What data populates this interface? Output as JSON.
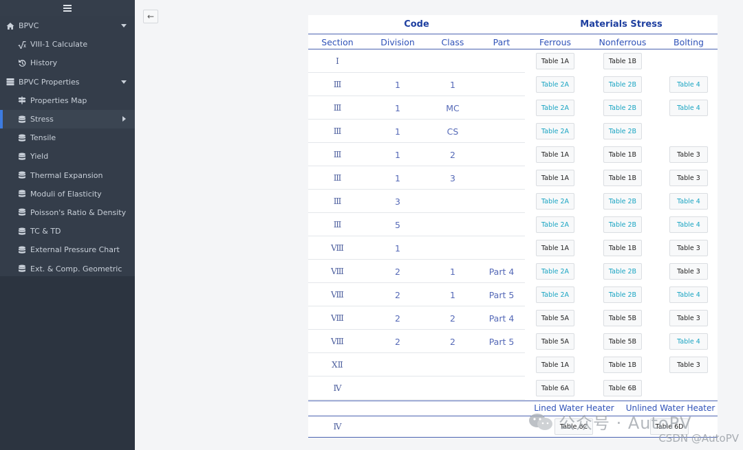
{
  "sidebar": {
    "items": [
      {
        "label": "BPVC",
        "icon": "home-icon",
        "level": 0,
        "caret": "down"
      },
      {
        "label": "VIII-1 Calculate",
        "icon": "square-root-icon",
        "level": 1
      },
      {
        "label": "History",
        "icon": "history-icon",
        "level": 1
      },
      {
        "label": "BPVC Properties",
        "icon": "server-icon",
        "level": 0,
        "caret": "down"
      },
      {
        "label": "Properties Map",
        "icon": "signpost-icon",
        "level": 1
      },
      {
        "label": "Stress",
        "icon": "database-icon",
        "level": 1,
        "active": true,
        "caret": "right"
      },
      {
        "label": "Tensile",
        "icon": "database-icon",
        "level": 1
      },
      {
        "label": "Yield",
        "icon": "database-icon",
        "level": 1
      },
      {
        "label": "Thermal Expansion",
        "icon": "database-icon",
        "level": 1
      },
      {
        "label": "Moduli of Elasticity",
        "icon": "database-icon",
        "level": 1
      },
      {
        "label": "Poisson's Ratio & Density",
        "icon": "database-icon",
        "level": 1
      },
      {
        "label": "TC & TD",
        "icon": "database-icon",
        "level": 1
      },
      {
        "label": "External Pressure Chart",
        "icon": "database-icon",
        "level": 1
      },
      {
        "label": "Ext. & Comp. Geometric",
        "icon": "database-icon",
        "level": 1
      }
    ]
  },
  "back_button": {
    "label": "←"
  },
  "table": {
    "group_code": "Code",
    "group_materials": "Materials Stress",
    "columns": [
      "Section",
      "Division",
      "Class",
      "Part",
      "Ferrous",
      "Nonferrous",
      "Bolting"
    ],
    "rows": [
      {
        "section": "Ⅰ",
        "division": "",
        "class": "",
        "part": "",
        "ferrous": "Table 1A",
        "nonferrous": "Table 1B",
        "bolting": ""
      },
      {
        "section": "Ⅲ",
        "division": "1",
        "class": "1",
        "part": "",
        "ferrous": "Table 2A",
        "nonferrous": "Table 2B",
        "bolting": "Table 4"
      },
      {
        "section": "Ⅲ",
        "division": "1",
        "class": "MC",
        "part": "",
        "ferrous": "Table 2A",
        "nonferrous": "Table 2B",
        "bolting": "Table 4"
      },
      {
        "section": "Ⅲ",
        "division": "1",
        "class": "CS",
        "part": "",
        "ferrous": "Table 2A",
        "nonferrous": "Table 2B",
        "bolting": ""
      },
      {
        "section": "Ⅲ",
        "division": "1",
        "class": "2",
        "part": "",
        "ferrous": "Table 1A",
        "nonferrous": "Table 1B",
        "bolting": "Table 3"
      },
      {
        "section": "Ⅲ",
        "division": "1",
        "class": "3",
        "part": "",
        "ferrous": "Table 1A",
        "nonferrous": "Table 1B",
        "bolting": "Table 3"
      },
      {
        "section": "Ⅲ",
        "division": "3",
        "class": "",
        "part": "",
        "ferrous": "Table 2A",
        "nonferrous": "Table 2B",
        "bolting": "Table 4"
      },
      {
        "section": "Ⅲ",
        "division": "5",
        "class": "",
        "part": "",
        "ferrous": "Table 2A",
        "nonferrous": "Table 2B",
        "bolting": "Table 4"
      },
      {
        "section": "Ⅷ",
        "division": "1",
        "class": "",
        "part": "",
        "ferrous": "Table 1A",
        "nonferrous": "Table 1B",
        "bolting": "Table 3"
      },
      {
        "section": "Ⅷ",
        "division": "2",
        "class": "1",
        "part": "Part 4",
        "ferrous": "Table 2A",
        "nonferrous": "Table 2B",
        "bolting": "Table 3"
      },
      {
        "section": "Ⅷ",
        "division": "2",
        "class": "1",
        "part": "Part 5",
        "ferrous": "Table 2A",
        "nonferrous": "Table 2B",
        "bolting": "Table 4"
      },
      {
        "section": "Ⅷ",
        "division": "2",
        "class": "2",
        "part": "Part 4",
        "ferrous": "Table 5A",
        "nonferrous": "Table 5B",
        "bolting": "Table 3"
      },
      {
        "section": "Ⅷ",
        "division": "2",
        "class": "2",
        "part": "Part 5",
        "ferrous": "Table 5A",
        "nonferrous": "Table 5B",
        "bolting": "Table 4"
      },
      {
        "section": "ⅩⅡ",
        "division": "",
        "class": "",
        "part": "",
        "ferrous": "Table 1A",
        "nonferrous": "Table 1B",
        "bolting": "Table 3"
      },
      {
        "section": "Ⅳ",
        "division": "",
        "class": "",
        "part": "",
        "ferrous": "Table 6A",
        "nonferrous": "Table 6B",
        "bolting": ""
      }
    ],
    "link_cells": [
      "Table 2A",
      "Table 2B",
      "Table 4"
    ],
    "link_exceptions": [
      [
        9,
        "bolting"
      ]
    ],
    "heater": {
      "lined_label": "Lined Water Heater",
      "unlined_label": "Unlined Water Heater",
      "section": "Ⅳ",
      "lined_table": "Table 6C",
      "unlined_table": "Table 6D"
    }
  },
  "watermark": {
    "primary": "公众号 · AutoPV",
    "secondary": "CSDN @AutoPV"
  },
  "colors": {
    "sidebar_bg": "#2c3440",
    "accent": "#3d7be0",
    "header_text": "#1e3fa0",
    "link": "#19a4c2"
  }
}
